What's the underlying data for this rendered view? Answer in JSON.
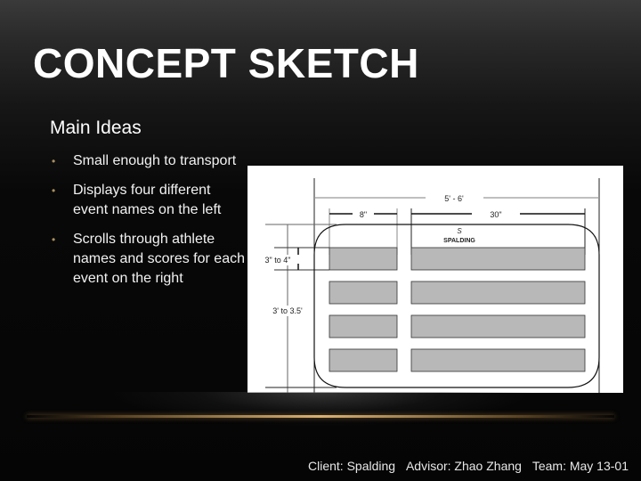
{
  "slide": {
    "title": "CONCEPT SKETCH",
    "subheading": "Main Ideas",
    "bullets": [
      "Small enough to transport",
      "Displays four different event names on the left",
      "Scrolls through athlete names and scores for each event on the right"
    ]
  },
  "sketch": {
    "overall_width_label": "5' - 6'",
    "left_column_width_label": "8\"",
    "right_column_width_label": "30\"",
    "row_height_label": "3\" to 4\"",
    "overall_height_label": "3' to 3.5'",
    "logo_text": "SPALDING",
    "row_count": 4,
    "row_fill_color": "#b8b8b8"
  },
  "footer": {
    "client": "Client: Spalding",
    "advisor": "Advisor: Zhao Zhang",
    "team": "Team: May 13-01"
  },
  "colors": {
    "bullet_accent": "#a89060",
    "divider_gold": "#d9b071"
  }
}
